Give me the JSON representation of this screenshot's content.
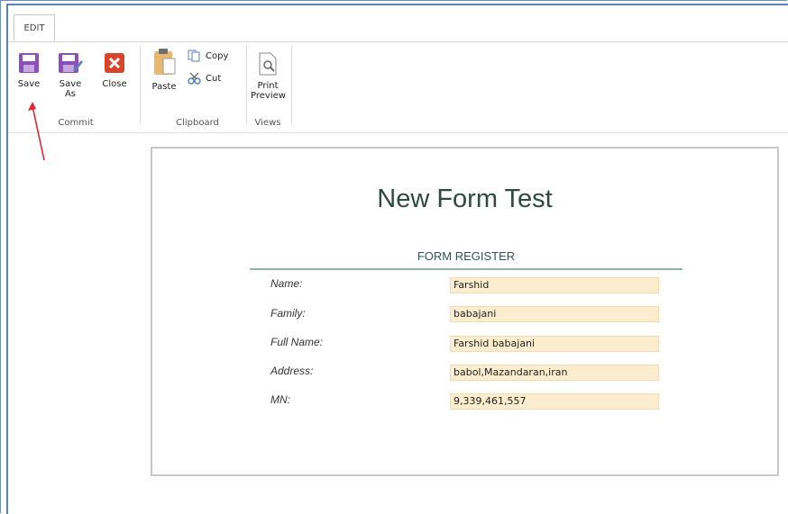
{
  "ribbon": {
    "tab_label": "EDIT",
    "commit": {
      "save_label": "Save",
      "save_as_label": "Save As",
      "close_label": "Close",
      "group_label": "Commit"
    },
    "clipboard": {
      "paste_label": "Paste",
      "copy_label": "Copy",
      "cut_label": "Cut",
      "group_label": "Clipboard"
    },
    "views": {
      "print_preview_label": "Print Preview",
      "group_label": "Views"
    },
    "colors": {
      "save": "#8a4fb8",
      "close": "#d9452b",
      "accent": "#5a80bd"
    }
  },
  "form": {
    "title": "New Form Test",
    "section_title": "FORM REGISTER",
    "fields": [
      {
        "label": "Name:",
        "value": "Farshid"
      },
      {
        "label": "Family:",
        "value": "babajani"
      },
      {
        "label": "Full Name:",
        "value": "Farshid babajani"
      },
      {
        "label": "Address:",
        "value": "babol,Mazandaran,iran"
      },
      {
        "label": "MN:",
        "value": "9,339,461,557"
      }
    ],
    "field_bg": "#fbedcd"
  },
  "annotation": {
    "icon": "red-arrow-icon",
    "color": "#e3262e"
  }
}
